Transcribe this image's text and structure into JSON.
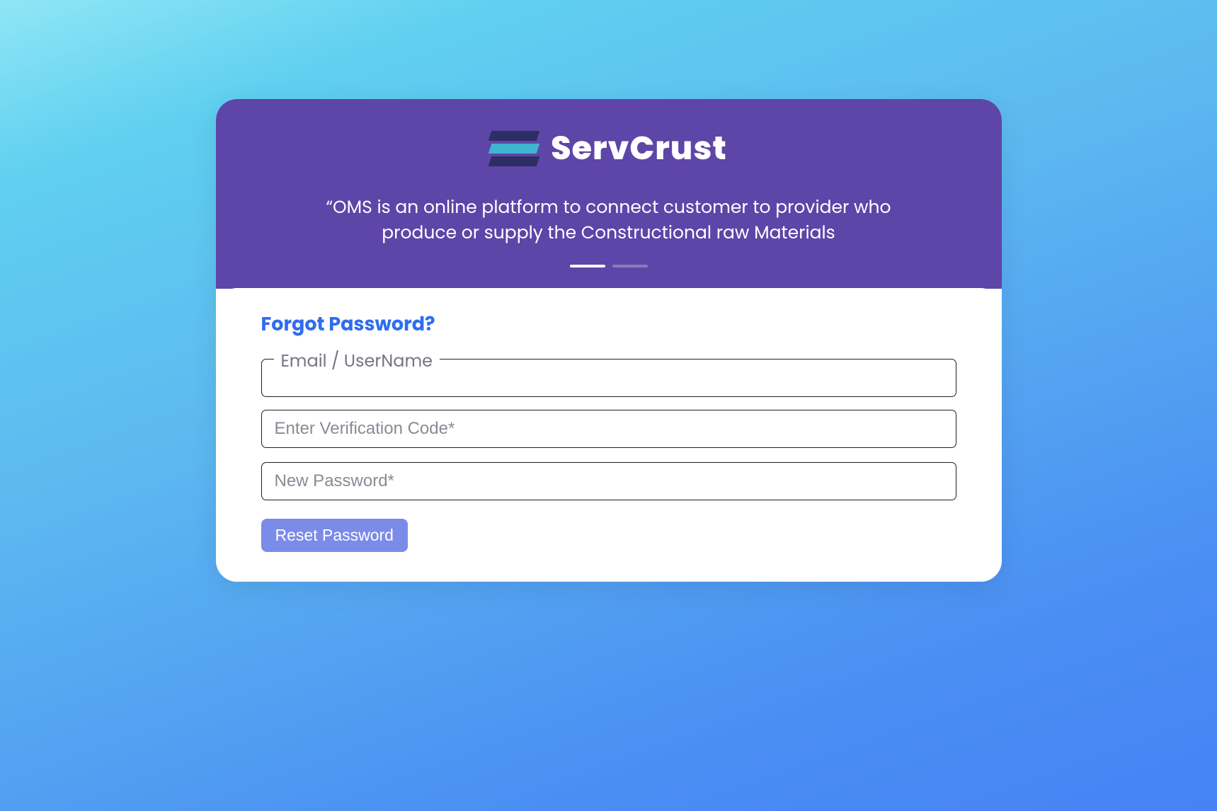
{
  "brand": {
    "name": "ServCrust",
    "tagline": "“OMS is an online platform to connect customer to provider who produce or supply the Constructional raw Materials"
  },
  "carousel": {
    "dots": [
      {
        "active": true
      },
      {
        "active": false
      }
    ]
  },
  "form": {
    "title": "Forgot Password?",
    "fields": {
      "email": {
        "label": "Email / UserName",
        "value": ""
      },
      "code": {
        "placeholder": "Enter Verification Code*",
        "value": ""
      },
      "password": {
        "placeholder": "New Password*",
        "value": ""
      }
    },
    "submit_label": "Reset Password"
  }
}
